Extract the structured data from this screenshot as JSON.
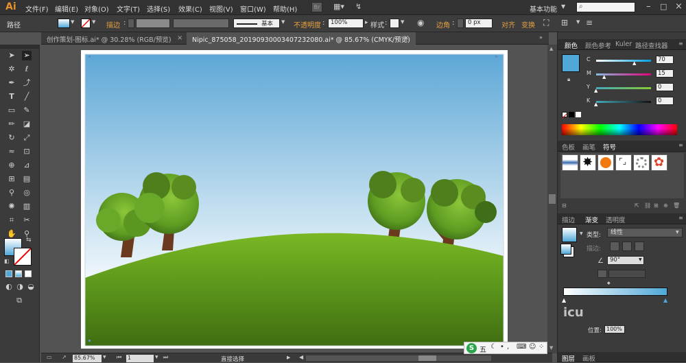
{
  "app": {
    "logo": "Ai",
    "workspace": "基本功能"
  },
  "menu": [
    "文件(F)",
    "编辑(E)",
    "对象(O)",
    "文字(T)",
    "选择(S)",
    "效果(C)",
    "视图(V)",
    "窗口(W)",
    "帮助(H)"
  ],
  "control": {
    "object_type": "路径",
    "stroke_label": "描边",
    "stroke_style": "基本",
    "opacity_label": "不透明度",
    "opacity_value": "100%",
    "style_label": "样式",
    "corner_label": "边角",
    "corner_value": "0 px",
    "align_label": "对齐",
    "transform_label": "变换"
  },
  "tabs": [
    {
      "label": "创作策划-图标.ai* @ 30.28% (RGB/预览)"
    },
    {
      "label": "Nipic_875058_20190930003407232080.ai* @ 85.67% (CMYK/预览)"
    }
  ],
  "status": {
    "zoom": "85.67%",
    "page": "1",
    "tool": "直接选择"
  },
  "panels": {
    "color_tabs": [
      "颜色",
      "颜色参考",
      "Kuler",
      "路径查找器"
    ],
    "cmyk": [
      {
        "label": "C",
        "value": "70"
      },
      {
        "label": "M",
        "value": "15"
      },
      {
        "label": "Y",
        "value": "0"
      },
      {
        "label": "K",
        "value": "0"
      }
    ],
    "swatch_tabs": [
      "色板",
      "画笔",
      "符号"
    ],
    "gradient_tabs": [
      "描边",
      "渐变",
      "透明度"
    ],
    "gradient_type_label": "类型:",
    "gradient_type_value": "线性",
    "gradient_stroke_label": "描边:",
    "gradient_angle": "90°",
    "gradient_location_label": "位置:",
    "gradient_location_value": "100%",
    "bottom_tabs": [
      "图层",
      "画板"
    ],
    "ime_label": "五"
  },
  "colors": {
    "sky_top": "#5da7d6",
    "sky_bottom": "#eef6fb",
    "hill_top": "#7ab824",
    "hill_bottom": "#3f6d12",
    "fill_swatch": "#4fa8d8",
    "accent": "#e8902a"
  }
}
